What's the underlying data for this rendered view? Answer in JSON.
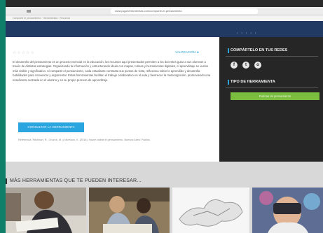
{
  "browser": {
    "url": "www.jugoherramientas.com/comparte-el-pensamiento",
    "bookmarks": "Comparte el pensamiento   ·   Herramientas   ·   Recursos"
  },
  "article": {
    "rating_stars": "☆☆☆☆☆",
    "rate_label": "VALORACIÓN  ★",
    "paragraph": "El desarrollo del pensamiento es un proceso esencial en la educación, los recursos aquí presentados permiten a los docentes guiar a sus alumnos a través de distintas estrategias. Organizando la información y estructurando ideas con mapas, rutinas y herramientas digitales, el aprendizaje se vuelve más visible y significativo. Al compartir el pensamiento, cada estudiante contrasta sus puntos de vista, reflexiona sobre lo aprendido y desarrolla habilidades para comunicar y argumentar. Estas herramientas facilitan el trabajo colaborativo en el aula y favorecen la metacognición, promoviendo una enseñanza centrada en el alumno y en su propio proceso de aprendizaje.",
    "cta_label": "CONSULTAR LA HERRAMIENTA",
    "reference": "Referencia: Ritchhart, R., Church, M. y Morrison, K. (2014). Hacer visible el pensamiento. Buenos Aires: Paidós."
  },
  "sidebar": {
    "share_title": "COMPÁRTELO EN TUS REDES",
    "social": [
      {
        "icon": "facebook-icon",
        "glyph": "f"
      },
      {
        "icon": "twitter-icon",
        "glyph": "t"
      },
      {
        "icon": "link-icon",
        "glyph": "o"
      }
    ],
    "type_title": "TIPO DE HERRAMIENTA",
    "type_button": "Rutinas de pensamiento"
  },
  "more": {
    "title": "MÁS HERRAMIENTAS QUE TE PUEDEN INTERESAR..."
  },
  "colors": {
    "nav": "#213a63",
    "accent_blue": "#2aa5e0",
    "accent_green": "#7bbd3f",
    "sidebar_bg": "#262626",
    "teal_edge": "#0f7f6a"
  }
}
